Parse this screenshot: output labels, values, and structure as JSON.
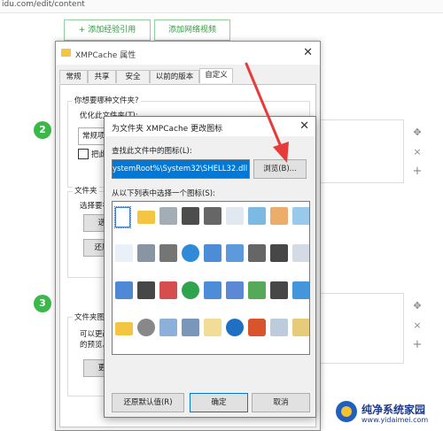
{
  "browser": {
    "url": "idu.com/edit/content"
  },
  "editor": {
    "add_reference_label": "+ 添加经验引用",
    "add_video_label": "添加网络视频",
    "step2": "2",
    "step3": "3",
    "move_icon": "✥",
    "delete_icon": "×",
    "add_icon": "+"
  },
  "properties_window": {
    "title": "XMPCache 属性",
    "tabs": [
      "常规",
      "共享",
      "安全",
      "以前的版本",
      "自定义"
    ],
    "active_tab": "自定义",
    "section1_label": "你想要哪种文件夹?",
    "optimize_label": "优化此文件夹(T):",
    "optimize_value": "常规项",
    "apply_subfolders_label": "把此",
    "section2_label": "文件夹",
    "choose_label": "选择要在",
    "choose_btn": "选",
    "restore_btn": "还原",
    "section3_label": "文件夹图",
    "desc_line1": "可以更改",
    "desc_line2": "的预览。",
    "change_btn": "更"
  },
  "icon_dialog": {
    "title": "为文件夹 XMPCache 更改图标",
    "find_label": "查找此文件中的图标(L):",
    "path_value": "ystemRoot%\\System32\\SHELL32.dll",
    "browse_btn": "浏览(B)...",
    "select_label": "从以下列表中选择一个图标(S):",
    "restore_default_btn": "还原默认值(R)",
    "ok_btn": "确定",
    "cancel_btn": "取消",
    "icons": [
      "blank-document-icon",
      "folder-icon",
      "drive-icon",
      "chip-icon",
      "printer-drive-icon",
      "document-settings-icon",
      "monitor-icon",
      "hand-share-icon",
      "recycle-icon",
      "text-document-icon",
      "network-drive-icon",
      "disk-drive-icon",
      "earth-globe-icon",
      "box-icon",
      "network-computer-icon",
      "network-printer-icon",
      "shortcut-icon",
      "app-icon",
      "window-icon",
      "floppy-icon",
      "delete-icon",
      "globe-icon",
      "network-icon",
      "search-icon",
      "green-arrow-icon",
      "power-icon",
      "blue-bar-icon",
      "folder-icon",
      "cd-drive-icon",
      "user-icon",
      "laptop-icon",
      "grid-icon",
      "help-icon",
      "shutdown-icon",
      "trash-icon",
      "file-cabinet-icon"
    ]
  },
  "watermark": {
    "title": "纯净系统家园",
    "url": "www.yidaimei.com"
  },
  "annotation_color": "#e63b3b",
  "accent_green": "#3cb84a",
  "selection_blue": "#0078d7"
}
